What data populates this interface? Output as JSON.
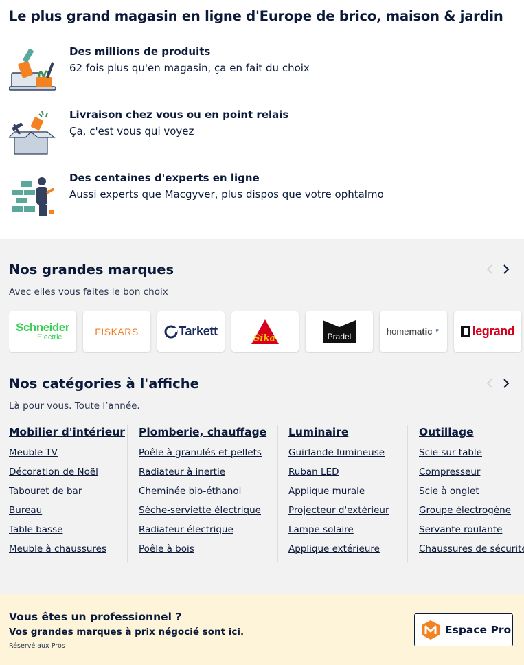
{
  "hero": {
    "title": "Le plus grand magasin en ligne d'Europe de brico, maison & jardin",
    "features": [
      {
        "icon": "tools-laptop-illustration",
        "title": "Des millions de produits",
        "subtitle": "62 fois plus qu'en magasin, ça en fait du choix"
      },
      {
        "icon": "delivery-box-illustration",
        "title": "Livraison chez vous ou en point relais",
        "subtitle": "Ça, c'est vous qui voyez"
      },
      {
        "icon": "expert-wall-illustration",
        "title": "Des centaines d'experts en ligne",
        "subtitle": "Aussi experts que Macgyver, plus dispos que votre ophtalmo"
      }
    ]
  },
  "brands": {
    "title": "Nos grandes marques",
    "subtitle": "Avec elles vous faites le bon choix",
    "logos": [
      {
        "name": "Schneider",
        "sub": "Electric",
        "color": "#3dcd58"
      },
      {
        "name": "FISKARS",
        "color": "#f47c20"
      },
      {
        "name": "Tarkett",
        "color": "#1a2a5a"
      },
      {
        "name": "Sika",
        "color": "#d6001c"
      },
      {
        "name": "Pradel",
        "color": "#111111"
      },
      {
        "name": "homematic",
        "prefix": "home",
        "suffix": "matic",
        "badge": "IP",
        "color": "#444444"
      },
      {
        "name": "legrand",
        "color": "#d6001c"
      }
    ]
  },
  "categories": {
    "title": "Nos catégories à l'affiche",
    "subtitle": "Là pour vous. Toute l’année.",
    "columns": [
      {
        "heading": "Mobilier d'intérieur",
        "items": [
          "Meuble TV",
          "Décoration de Noël",
          "Tabouret de bar",
          "Bureau",
          "Table basse",
          "Meuble à chaussures"
        ]
      },
      {
        "heading": "Plomberie, chauffage",
        "items": [
          "Poêle à granulés et pellets",
          "Radiateur à inertie",
          "Cheminée bio-éthanol",
          "Sèche-serviette électrique",
          "Radiateur électrique",
          "Poêle à bois"
        ]
      },
      {
        "heading": "Luminaire",
        "items": [
          "Guirlande lumineuse",
          "Ruban LED",
          "Applique murale",
          "Projecteur d'extérieur",
          "Lampe solaire",
          "Applique extérieure"
        ]
      },
      {
        "heading": "Outillage",
        "items": [
          "Scie sur table",
          "Compresseur",
          "Scie à onglet",
          "Groupe électrogène",
          "Servante roulante",
          "Chaussures de sécurité"
        ]
      }
    ]
  },
  "pro": {
    "title": "Vous êtes un professionnel ?",
    "subtitle": "Vos grandes marques à prix négocié sont ici.",
    "note": "Réservé aux Pros",
    "button_label": "Espace Pro",
    "button_icon": "manomano-pro-logo-icon",
    "accent": "#f58220"
  }
}
